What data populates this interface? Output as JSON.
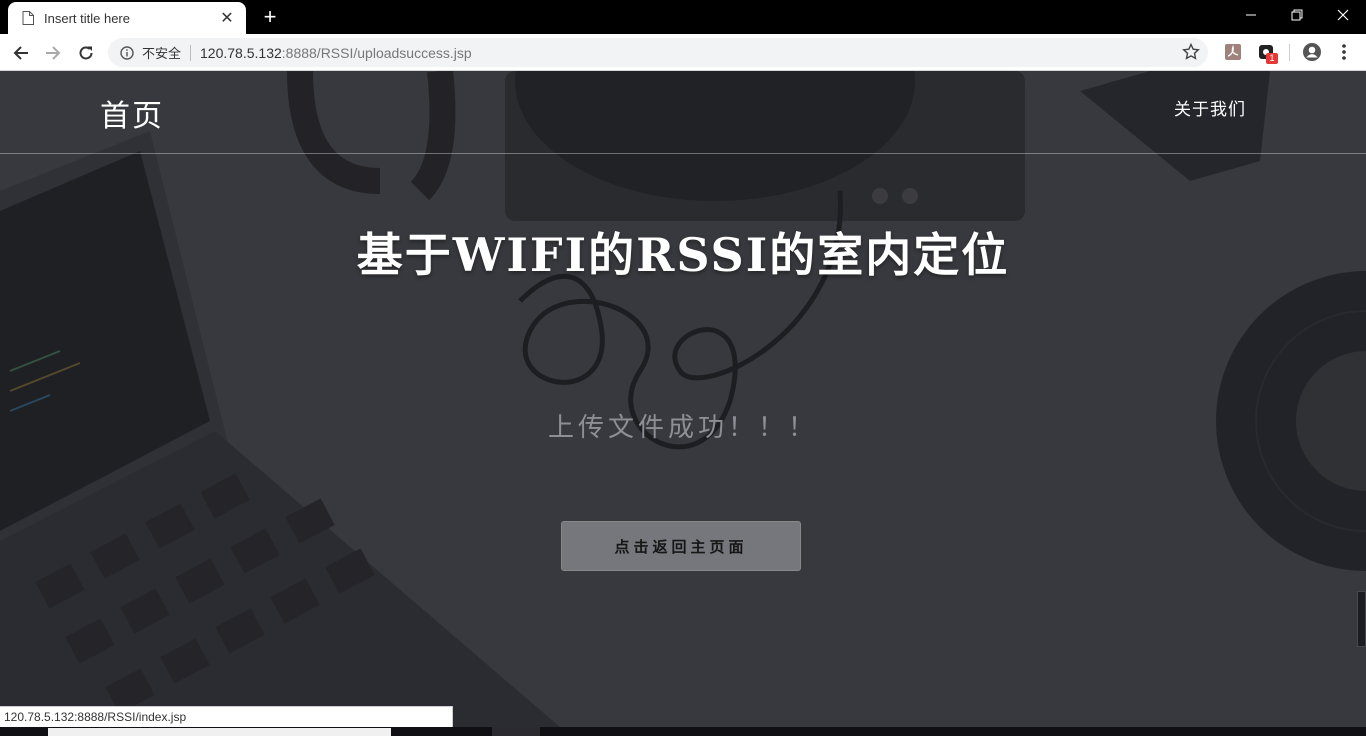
{
  "browser": {
    "tab_title": "Insert title here",
    "new_tab_label": "+",
    "security_label": "不安全",
    "url_host": "120.78.5.132",
    "url_rest": ":8888/RSSI/uploadsuccess.jsp",
    "extension_badge": "1",
    "icons": {
      "page": "page-icon",
      "close": "close-icon",
      "back": "back-arrow-icon",
      "forward": "forward-arrow-icon",
      "reload": "reload-icon",
      "info": "info-icon",
      "star": "bookmark-star-icon",
      "pdf": "pdf-extension-icon",
      "profile": "profile-icon",
      "menu": "kebab-menu-icon"
    }
  },
  "page": {
    "nav_home": "首页",
    "nav_about": "关于我们",
    "hero_title": "基于WIFI的RSSI的室内定位",
    "success_message": "上传文件成功！！！",
    "return_button": "点击返回主页面"
  },
  "status_bar": {
    "hover_url": "120.78.5.132:8888/RSSI/index.jsp"
  },
  "colors": {
    "overlay_bg": "#3b3c40",
    "button_bg": "#76777c",
    "message_text": "#8d8f96",
    "accent_badge": "#e53935"
  }
}
